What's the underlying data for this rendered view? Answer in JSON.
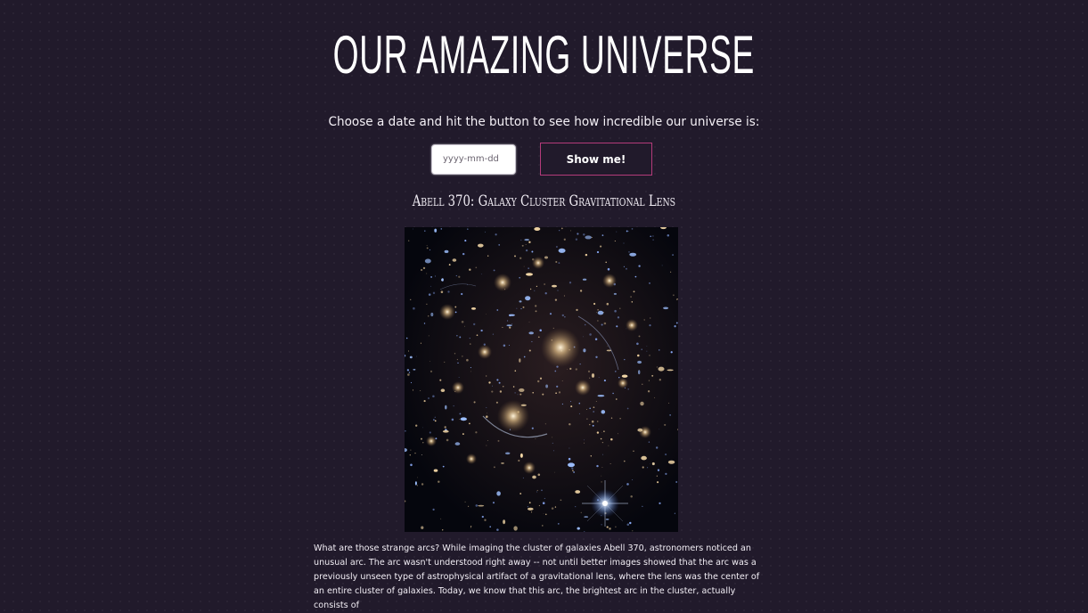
{
  "header": {
    "title": "OUR AMAZING UNIVERSE",
    "subtitle": "Choose a date and hit the button to see how incredible our universe is:"
  },
  "controls": {
    "date_placeholder": "yyyy-mm-dd",
    "button_label": "Show me!"
  },
  "apod": {
    "title": "Abell 370: Galaxy Cluster Gravitational Lens",
    "image_alt": "Abell 370 galaxy cluster",
    "explanation": "What are those strange arcs? While imaging the cluster of galaxies Abell 370, astronomers noticed an unusual arc. The arc wasn't understood right away -- not until better images showed that the arc was a previously unseen type of astrophysical artifact of a gravitational lens, where the lens was the center of an entire cluster of galaxies. Today, we know that this arc, the brightest arc in the cluster, actually consists of"
  },
  "colors": {
    "background": "#211a2b",
    "button_border": "#b43b7a",
    "text": "#ffffff"
  }
}
